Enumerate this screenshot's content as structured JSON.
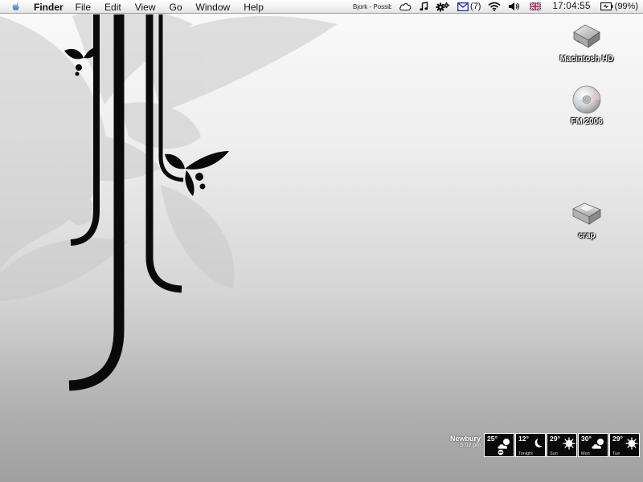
{
  "menubar": {
    "app_name": "Finder",
    "menus": [
      "File",
      "Edit",
      "View",
      "Go",
      "Window",
      "Help"
    ],
    "now_playing": "Bjork - Possibly Maybe",
    "mail_count": "(7)",
    "clock": "17:04:55",
    "battery": "(99%)"
  },
  "desktop_icons": [
    {
      "label": "Macintosh HD",
      "icon": "hard-drive-icon"
    },
    {
      "label": "FM 2006",
      "icon": "cd-disc-icon"
    },
    {
      "label": "crap",
      "icon": "folder-icon"
    }
  ],
  "weather": {
    "location": "Newbury",
    "time": "5:02 pm",
    "cells": [
      {
        "temp": "25°",
        "day": "",
        "icon": "partly-cloudy-icon"
      },
      {
        "temp": "12°",
        "day": "Tonight",
        "icon": "moon-icon"
      },
      {
        "temp": "29°",
        "day": "Sun",
        "icon": "sun-icon"
      },
      {
        "temp": "30°",
        "day": "Mon",
        "icon": "partly-cloudy-icon"
      },
      {
        "temp": "29°",
        "day": "Tue",
        "icon": "sun-icon"
      }
    ]
  }
}
